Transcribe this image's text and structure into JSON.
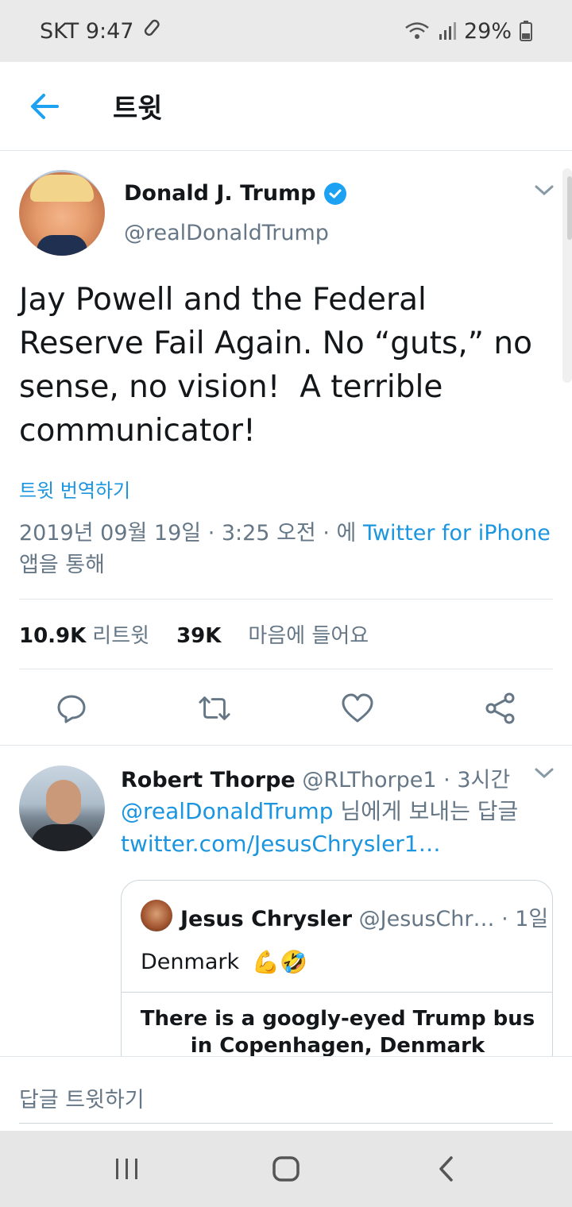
{
  "status_bar": {
    "carrier_time": "SKT 9:47",
    "battery": "29%"
  },
  "header": {
    "title": "트윗"
  },
  "tweet": {
    "author_name": "Donald J. Trump",
    "handle": "@realDonaldTrump",
    "text": "Jay Powell and the Federal\nReserve Fail Again. No “guts,” no\nsense, no vision!  A terrible\ncommunicator!",
    "translate": "트윗 번역하기",
    "date": "2019년 09월 19일 · 3:25 오전 · 에 ",
    "source": "Twitter for iPhone",
    "via": "앱을 통해",
    "retweets_count": "10.9K",
    "retweets_label": "리트윗",
    "likes_count": "39K",
    "likes_label": "마음에 들어요"
  },
  "reply": {
    "name": "Robert Thorpe",
    "handle_time": " @RLThorpe1 · 3시간",
    "reply_to_mention": "@realDonaldTrump",
    "reply_to_suffix": " 님에게 보내는 답글",
    "link": "twitter.com/JesusChrysler1…",
    "quote": {
      "name": "Jesus Chrysler",
      "handle_time": " @JesusChr… · 1일",
      "text": "Denmark",
      "emojis": "💪🤣",
      "media_text_1": "There is a googly-eyed Trump bus",
      "media_text_2": "in Copenhagen, Denmark"
    }
  },
  "composer": {
    "placeholder": "답글 트윗하기"
  },
  "colors": {
    "accent": "#1da1f2",
    "link": "#1b95e0",
    "muted": "#657786"
  }
}
